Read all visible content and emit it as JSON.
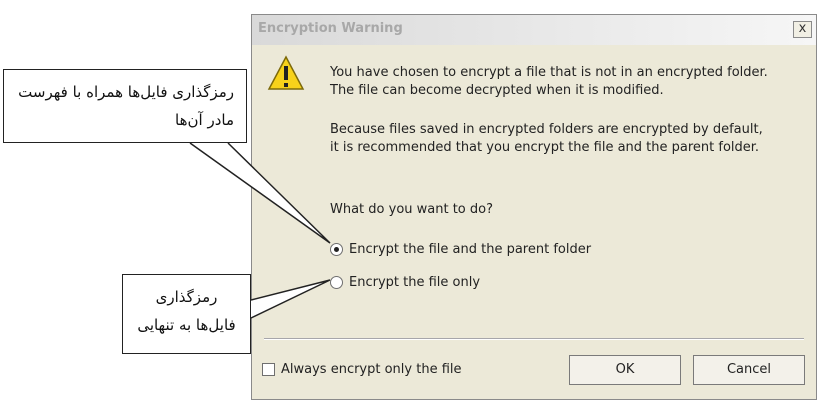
{
  "dialog": {
    "title": "Encryption Warning",
    "close_label": "x",
    "message1": "You have chosen to encrypt a file that is not in an encrypted folder. The file can become decrypted when it is modified.",
    "message2": "Because files saved in encrypted folders are encrypted by default, it is recommended that you encrypt the file and the parent folder.",
    "question": "What do you want to do?",
    "options": [
      {
        "label": "Encrypt the file and the parent folder",
        "checked": true
      },
      {
        "label": "Encrypt the file only",
        "checked": false
      }
    ],
    "checkbox": {
      "label": "Always encrypt only the file",
      "checked": false
    },
    "ok_label": "OK",
    "cancel_label": "Cancel",
    "icon": "warning-icon"
  },
  "callouts": {
    "top_text": "رمزگذاری فایل‌ها همراه با فهرست مادر آن‌ها",
    "bottom_text": "رمزگذاری فایل‌ها به تنهایی"
  }
}
